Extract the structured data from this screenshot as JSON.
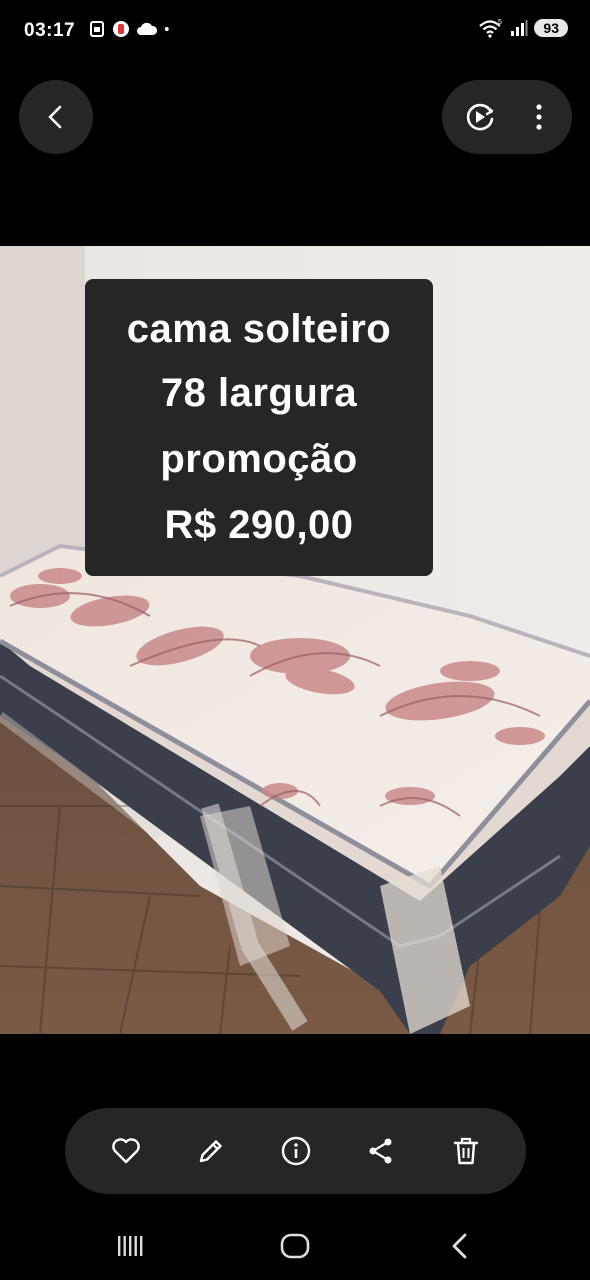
{
  "status_bar": {
    "time": "03:17",
    "battery": "93",
    "left_icons": [
      "sim-icon",
      "recording-icon",
      "cloud-icon",
      "dot-icon"
    ],
    "right_icons": [
      "wifi-icon",
      "signal-icon"
    ]
  },
  "header": {
    "back_icon": "chevron-left-icon",
    "actions": [
      "motion-photo-play-icon",
      "more-vertical-icon"
    ]
  },
  "photo": {
    "caption_lines": [
      "cama solteiro",
      "78 largura",
      "promoção",
      "R$ 290,00"
    ]
  },
  "toolbar": {
    "buttons": [
      "heart-icon",
      "edit-icon",
      "info-icon",
      "share-icon",
      "delete-icon"
    ]
  },
  "nav_bar": {
    "buttons": [
      "recent-apps-icon",
      "home-icon",
      "back-icon"
    ]
  }
}
